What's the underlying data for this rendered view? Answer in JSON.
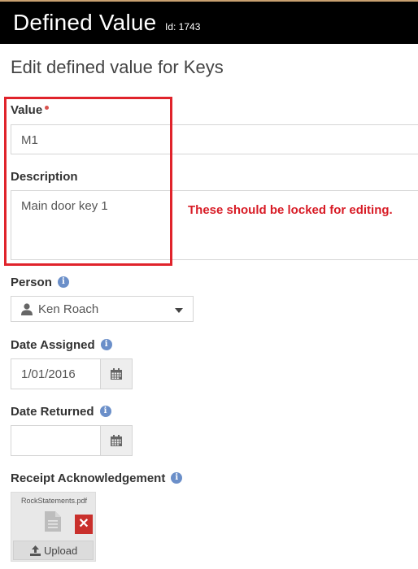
{
  "header": {
    "title": "Defined Value",
    "id_text": "Id: 1743"
  },
  "subtitle": "Edit defined value for Keys",
  "fields": {
    "value_label": "Value",
    "value": "M1",
    "description_label": "Description",
    "description": "Main door key 1",
    "person_label": "Person",
    "person_value": "Ken Roach",
    "date_assigned_label": "Date Assigned",
    "date_assigned_value": "1/01/2016",
    "date_returned_label": "Date Returned",
    "date_returned_value": "",
    "receipt_label": "Receipt Acknowledgement"
  },
  "attachment": {
    "filename": "RockStatements.pdf",
    "remove_symbol": "✕",
    "upload_label": "Upload"
  },
  "annotation": "These should be locked for editing.",
  "colors": {
    "header_bg": "#000000",
    "annotation": "#d81c26",
    "highlight_border": "#e0232b",
    "info_icon": "#6b8fc9",
    "remove_button": "#c9302c"
  },
  "icons": {
    "info": "info-circle-icon",
    "person": "user-icon",
    "calendar": "calendar-icon",
    "file": "file-icon",
    "upload": "upload-icon",
    "remove": "close-icon",
    "dropdown": "caret-down-icon"
  }
}
